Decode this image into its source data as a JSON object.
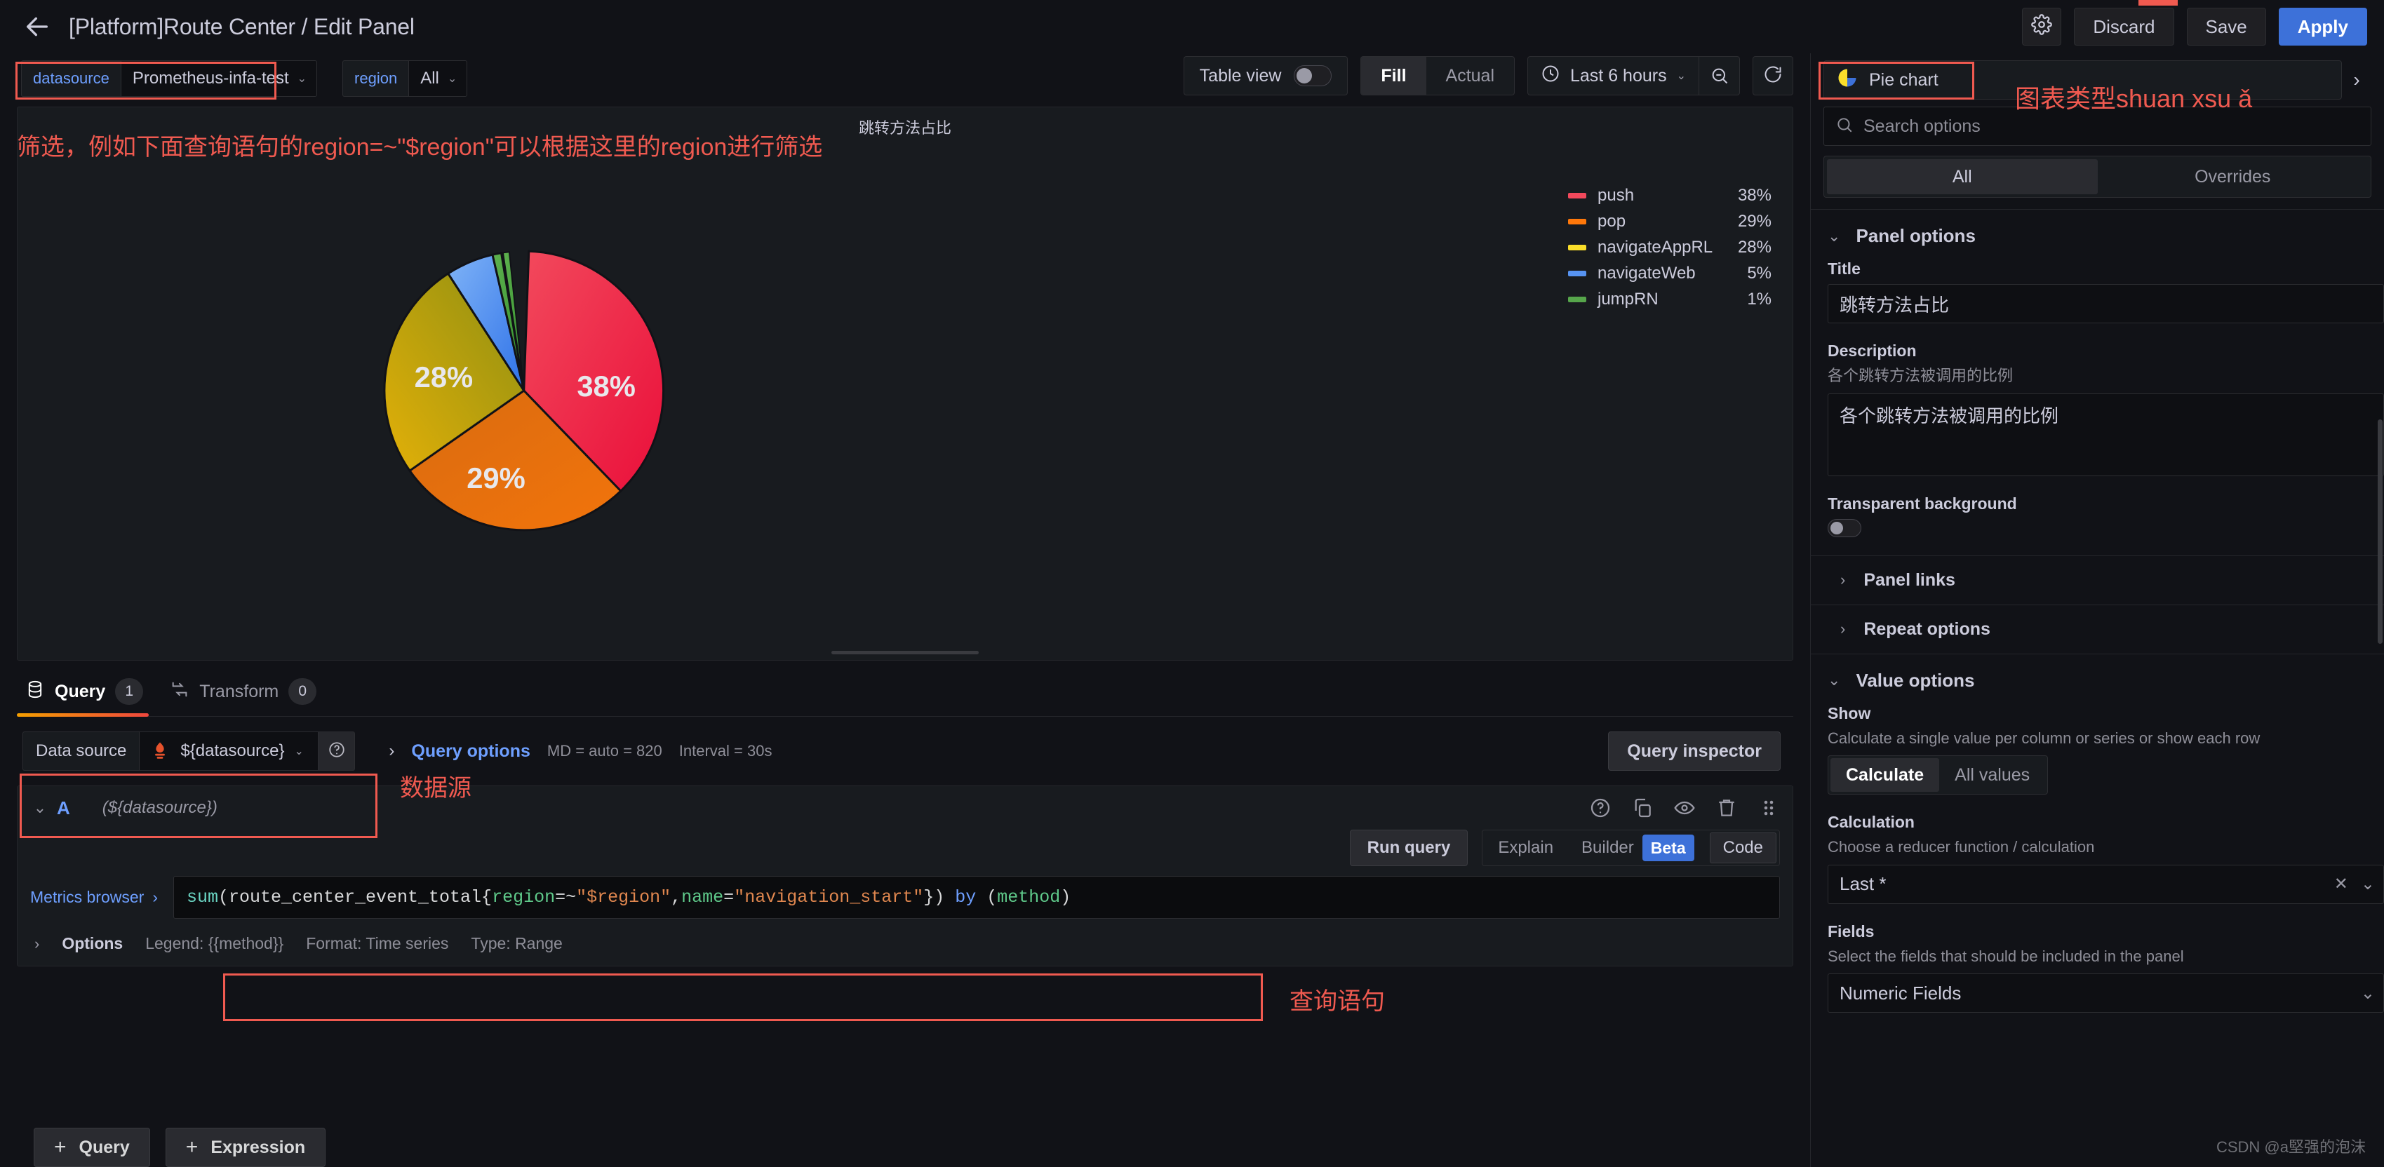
{
  "topbar": {
    "back_icon": "arrow-left-icon",
    "title": "[Platform]Route Center / Edit Panel",
    "settings_icon": "gear-icon",
    "discard_label": "Discard",
    "save_label": "Save",
    "apply_label": "Apply"
  },
  "variables": [
    {
      "label": "datasource",
      "value": "Prometheus-infa-test"
    },
    {
      "label": "region",
      "value": "All"
    }
  ],
  "annotations": {
    "filter_note": "筛选，例如下面查询语句的region=~\"$region\"可以根据这里的region进行筛选",
    "viz_type_note": "图表类型shuan xsu ǎ",
    "datasource_note": "数据源",
    "query_note": "查询语句"
  },
  "panel_toolbar": {
    "table_view_label": "Table view",
    "table_view_on": false,
    "fill_label": "Fill",
    "actual_label": "Actual",
    "fill_active": true,
    "time_range": "Last 6 hours",
    "clock_icon": "clock-icon",
    "zoom_out_icon": "zoom-out-icon",
    "refresh_icon": "refresh-icon"
  },
  "panel": {
    "title": "跳转方法占比"
  },
  "chart_data": {
    "type": "pie",
    "title": "跳转方法占比",
    "labels": [
      "push",
      "pop",
      "navigateAppRL",
      "navigateWeb",
      "jumpRN"
    ],
    "values": [
      38,
      29,
      28,
      5,
      1
    ],
    "value_suffix": "%",
    "colors": [
      "#f2495c",
      "#ff780a",
      "#fade2a",
      "#5794f2",
      "#56a64b"
    ],
    "slice_labels": [
      "38%",
      "29%",
      "28%",
      "",
      ""
    ],
    "legend_position": "right",
    "legend": [
      {
        "name": "push",
        "value": "38%",
        "color": "#f2495c"
      },
      {
        "name": "pop",
        "value": "29%",
        "color": "#ff780a"
      },
      {
        "name": "navigateAppRL",
        "value": "28%",
        "color": "#fade2a"
      },
      {
        "name": "navigateWeb",
        "value": "5%",
        "color": "#5794f2"
      },
      {
        "name": "jumpRN",
        "value": "1%",
        "color": "#56a64b"
      }
    ]
  },
  "query_tabs": [
    {
      "label": "Query",
      "badge": "1",
      "icon": "database-icon",
      "active": true
    },
    {
      "label": "Transform",
      "badge": "0",
      "icon": "transform-icon",
      "active": false
    }
  ],
  "query_editor": {
    "datasource_label": "Data source",
    "datasource_value": "${datasource}",
    "datasource_icon": "prometheus-icon",
    "help_icon": "help-circle-icon",
    "query_options_label": "Query options",
    "query_options_meta_md": "MD = auto = 820",
    "query_options_meta_interval": "Interval = 30s",
    "query_inspector_label": "Query inspector",
    "ref_id": "A",
    "ref_datasource": "(${datasource})",
    "row_icons": [
      "help-circle-icon",
      "copy-icon",
      "eye-icon",
      "trash-icon",
      "drag-handle-icon"
    ],
    "run_query_label": "Run query",
    "explain_label": "Explain",
    "builder_label": "Builder",
    "beta_label": "Beta",
    "code_label": "Code",
    "metrics_browser_label": "Metrics browser",
    "expr_tokens": [
      {
        "t": "sum",
        "c": "fn"
      },
      {
        "t": "(route_center_event_total{",
        "c": "plain"
      },
      {
        "t": "region",
        "c": "label"
      },
      {
        "t": "=~",
        "c": "op"
      },
      {
        "t": "\"$region\"",
        "c": "str"
      },
      {
        "t": ",",
        "c": "plain"
      },
      {
        "t": "name",
        "c": "label"
      },
      {
        "t": "=",
        "c": "op"
      },
      {
        "t": "\"navigation_start\"",
        "c": "str"
      },
      {
        "t": "})",
        "c": "plain"
      },
      {
        "t": " by ",
        "c": "by"
      },
      {
        "t": "(",
        "c": "plain"
      },
      {
        "t": "method",
        "c": "grp"
      },
      {
        "t": ")",
        "c": "plain"
      }
    ],
    "options_label": "Options",
    "options_legend": "Legend: {{method}}",
    "options_format": "Format: Time series",
    "options_type": "Type: Range",
    "add_query_label": "Query",
    "add_expression_label": "Expression",
    "plus_glyph": "+"
  },
  "sidebar": {
    "viz_picker_label": "Pie chart",
    "viz_picker_icon": "pie-chart-icon",
    "viz_picker_caret_icon": "chevron-right-icon",
    "search_placeholder": "Search options",
    "search_icon": "search-icon",
    "tab_all": "All",
    "tab_overrides": "Overrides",
    "panel_options_title": "Panel options",
    "title_label": "Title",
    "title_value": "跳转方法占比",
    "description_label": "Description",
    "description_help": "各个跳转方法被调用的比例",
    "description_value": "各个跳转方法被调用的比例",
    "transparent_label": "Transparent background",
    "transparent_on": false,
    "panel_links_label": "Panel links",
    "repeat_options_label": "Repeat options",
    "value_options_title": "Value options",
    "show_label": "Show",
    "show_desc": "Calculate a single value per column or series or show each row",
    "show_calculate": "Calculate",
    "show_all_values": "All values",
    "calculation_label": "Calculation",
    "calculation_desc": "Choose a reducer function / calculation",
    "calculation_value": "Last *",
    "clear_icon": "close-icon",
    "dropdown_icon": "chevron-down-icon",
    "fields_label": "Fields",
    "fields_desc": "Select the fields that should be included in the panel",
    "fields_value": "Numeric Fields"
  },
  "watermark": "CSDN @a堅强的泡沫"
}
